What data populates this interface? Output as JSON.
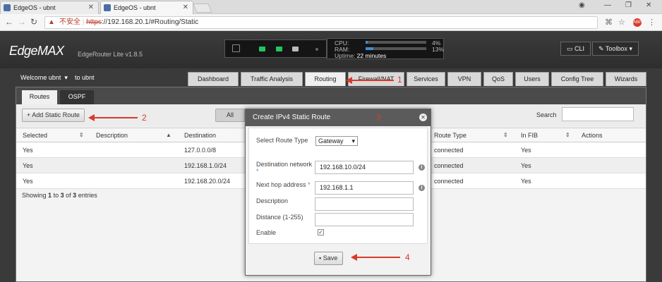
{
  "browser": {
    "tabs": [
      {
        "title": "EdgeOS - ubnt"
      },
      {
        "title": "EdgeOS - ubnt"
      }
    ],
    "insecure_label": "不安全",
    "url_https": "https",
    "url_rest": "://192.168.20.1/#Routing/Static"
  },
  "header": {
    "logo": "EdgeMAX",
    "model": "EdgeRouter Lite v1.8.5",
    "cpu_label": "CPU:",
    "cpu_value": "4%",
    "cpu_pct": 4,
    "ram_label": "RAM:",
    "ram_value": "13%",
    "ram_pct": 13,
    "uptime_label": "Uptime:",
    "uptime_value": "22 minutes",
    "cli_label": "CLI",
    "toolbox_label": "Toolbox"
  },
  "nav": {
    "welcome": "Welcome ubnt",
    "to": "to ubnt",
    "tabs": [
      "Dashboard",
      "Traffic Analysis",
      "Routing",
      "Firewall/NAT",
      "Services",
      "VPN",
      "QoS",
      "Users",
      "Config Tree",
      "Wizards"
    ]
  },
  "subtabs": [
    "Routes",
    "OSPF"
  ],
  "toolbar": {
    "add_static_route": "Add Static Route",
    "filter_all": "All",
    "search_label": "Search",
    "search_value": ""
  },
  "table": {
    "headers": [
      "Selected",
      "Description",
      "Destination",
      "Route Type",
      "In FIB",
      "Actions"
    ],
    "rows": [
      {
        "selected": "Yes",
        "description": "",
        "destination": "127.0.0.0/8",
        "route_type": "connected",
        "in_fib": "Yes"
      },
      {
        "selected": "Yes",
        "description": "",
        "destination": "192.168.1.0/24",
        "route_type": "connected",
        "in_fib": "Yes"
      },
      {
        "selected": "Yes",
        "description": "",
        "destination": "192.168.20.0/24",
        "route_type": "connected",
        "in_fib": "Yes"
      }
    ],
    "showing_prefix": "Showing",
    "showing_from": "1",
    "showing_to_word": "to",
    "showing_to": "3",
    "showing_of_word": "of",
    "showing_total": "3",
    "showing_suffix": "entries"
  },
  "modal": {
    "title": "Create IPv4 Static Route",
    "route_type_label": "Select Route Type",
    "route_type_value": "Gateway",
    "dest_label": "Destination network",
    "dest_value": "192.168.10.0/24",
    "nexthop_label": "Next hop address",
    "nexthop_value": "192.168.1.1",
    "desc_label": "Description",
    "desc_value": "",
    "distance_label": "Distance (1-255)",
    "distance_value": "",
    "enable_label": "Enable",
    "enable_checked": true,
    "save_label": "Save"
  },
  "annotations": [
    "1",
    "2",
    "3",
    "4"
  ],
  "colors": {
    "annotation": "#d93a2b",
    "accent": "#3d8fd6",
    "port_up": "#22c55e"
  }
}
